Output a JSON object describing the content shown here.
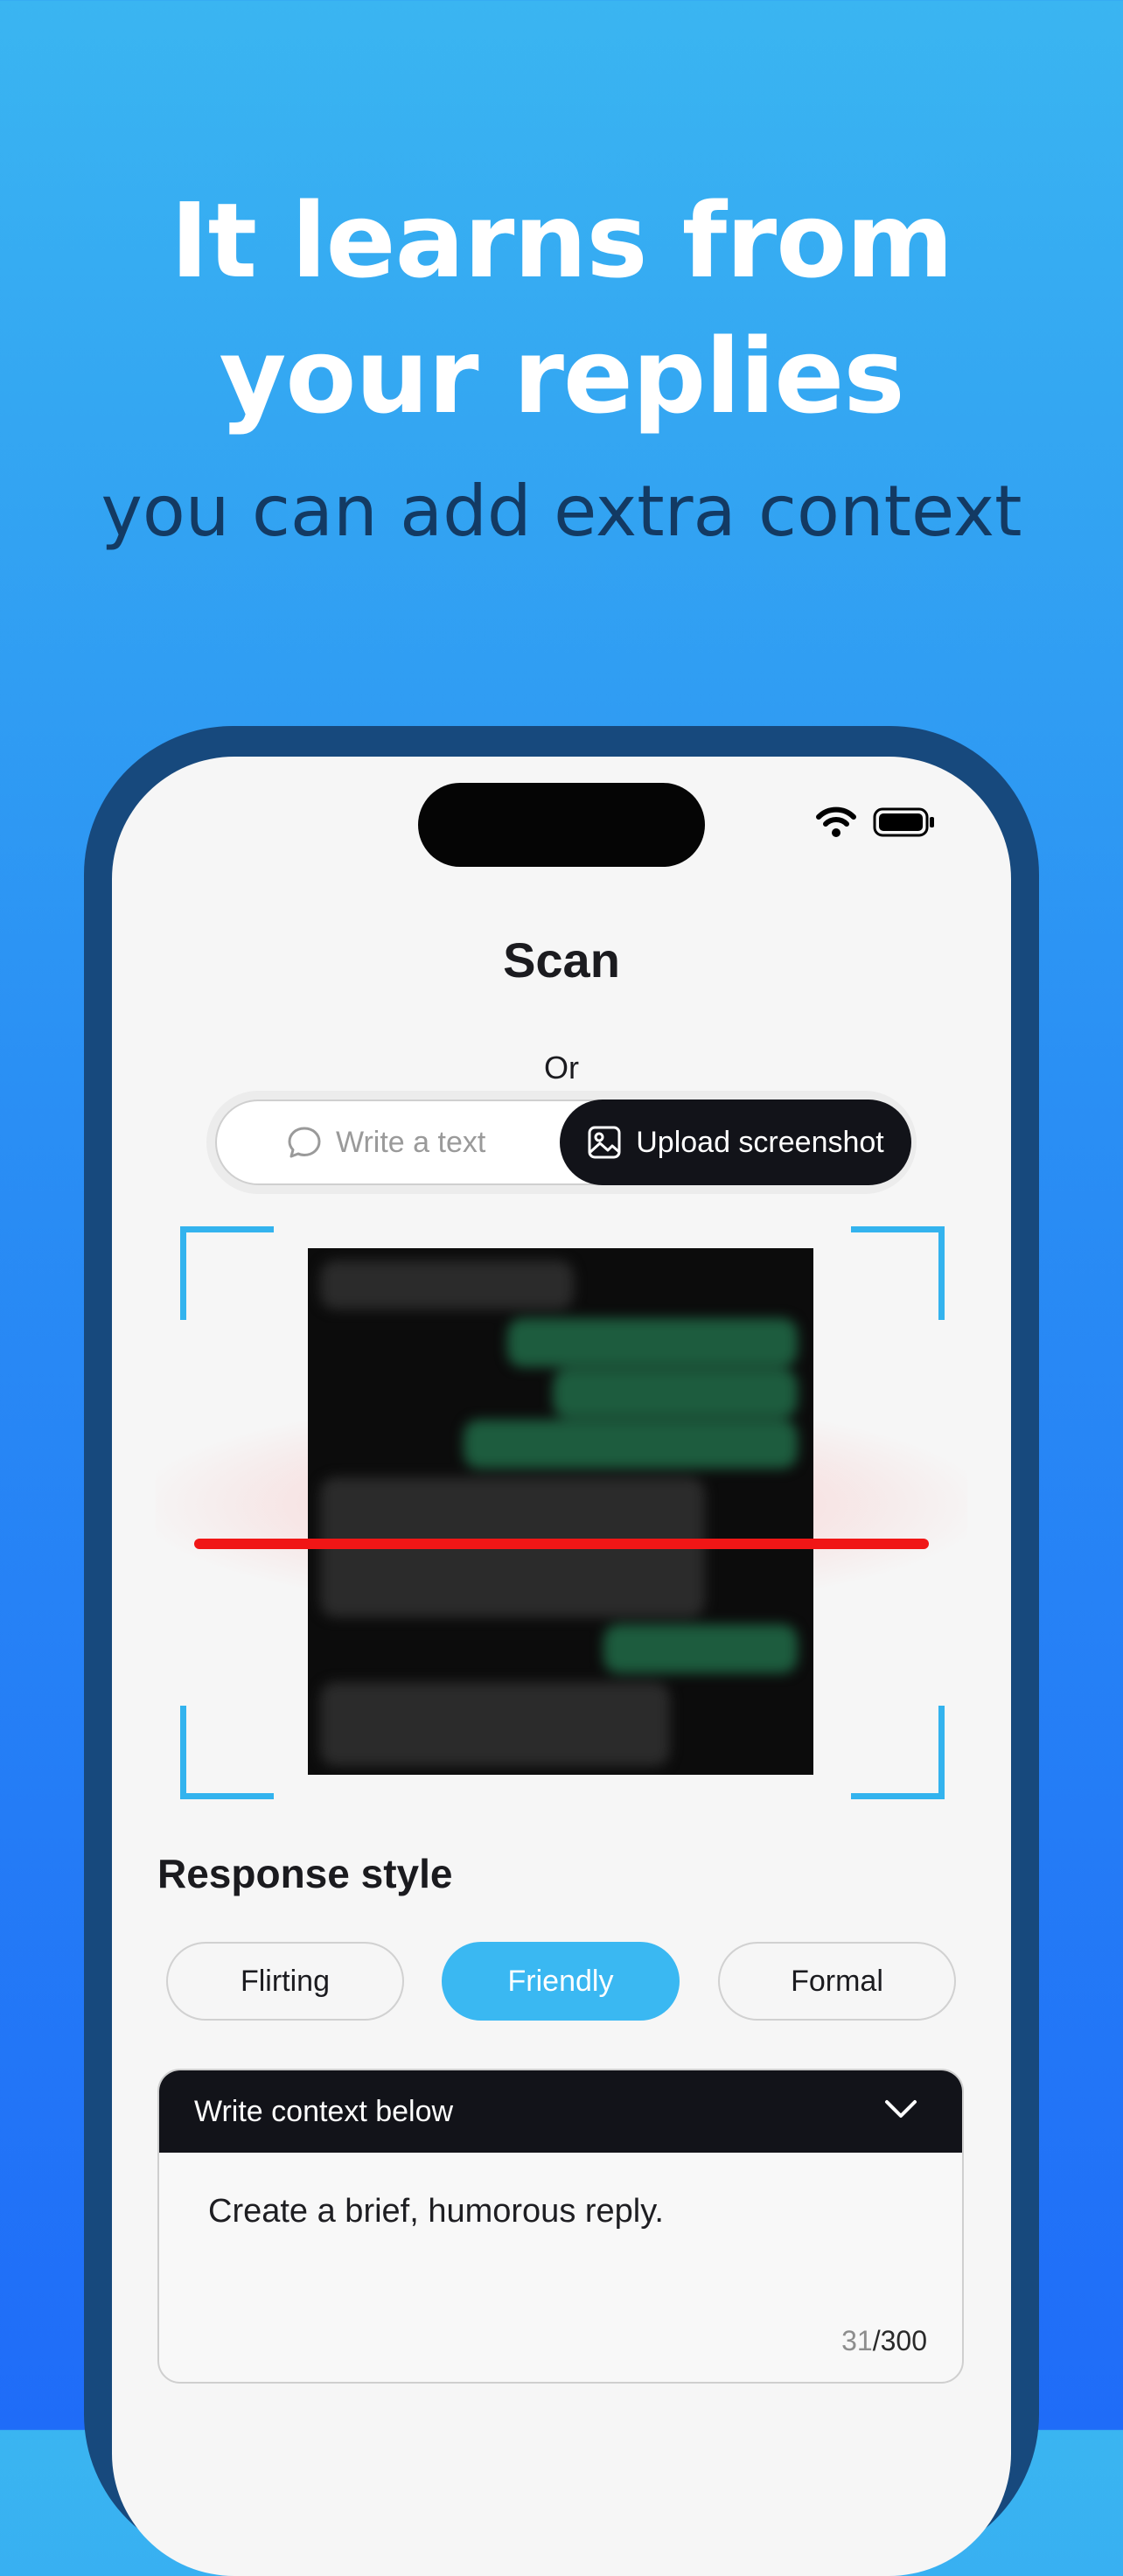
{
  "hero": {
    "line1": "It learns from",
    "line2": "your replies",
    "subtitle": "you can add extra context"
  },
  "status_bar": {
    "icons": [
      "wifi-icon",
      "battery-icon"
    ]
  },
  "screen": {
    "title": "Scan",
    "or_label": "Or",
    "segmented": {
      "write_label": "Write a text",
      "upload_label": "Upload screenshot",
      "selected": "Upload screenshot"
    },
    "response_style": {
      "title": "Response style",
      "options": [
        "Flirting",
        "Friendly",
        "Formal"
      ],
      "selected": "Friendly"
    },
    "context": {
      "header": "Write context below",
      "value": "Create a brief, humorous reply.",
      "count_current": "31",
      "count_max": "/300"
    }
  },
  "colors": {
    "accent": "#3ab8f2",
    "scan_line": "#f01616",
    "dark": "#121319",
    "frame": "#17497d"
  }
}
